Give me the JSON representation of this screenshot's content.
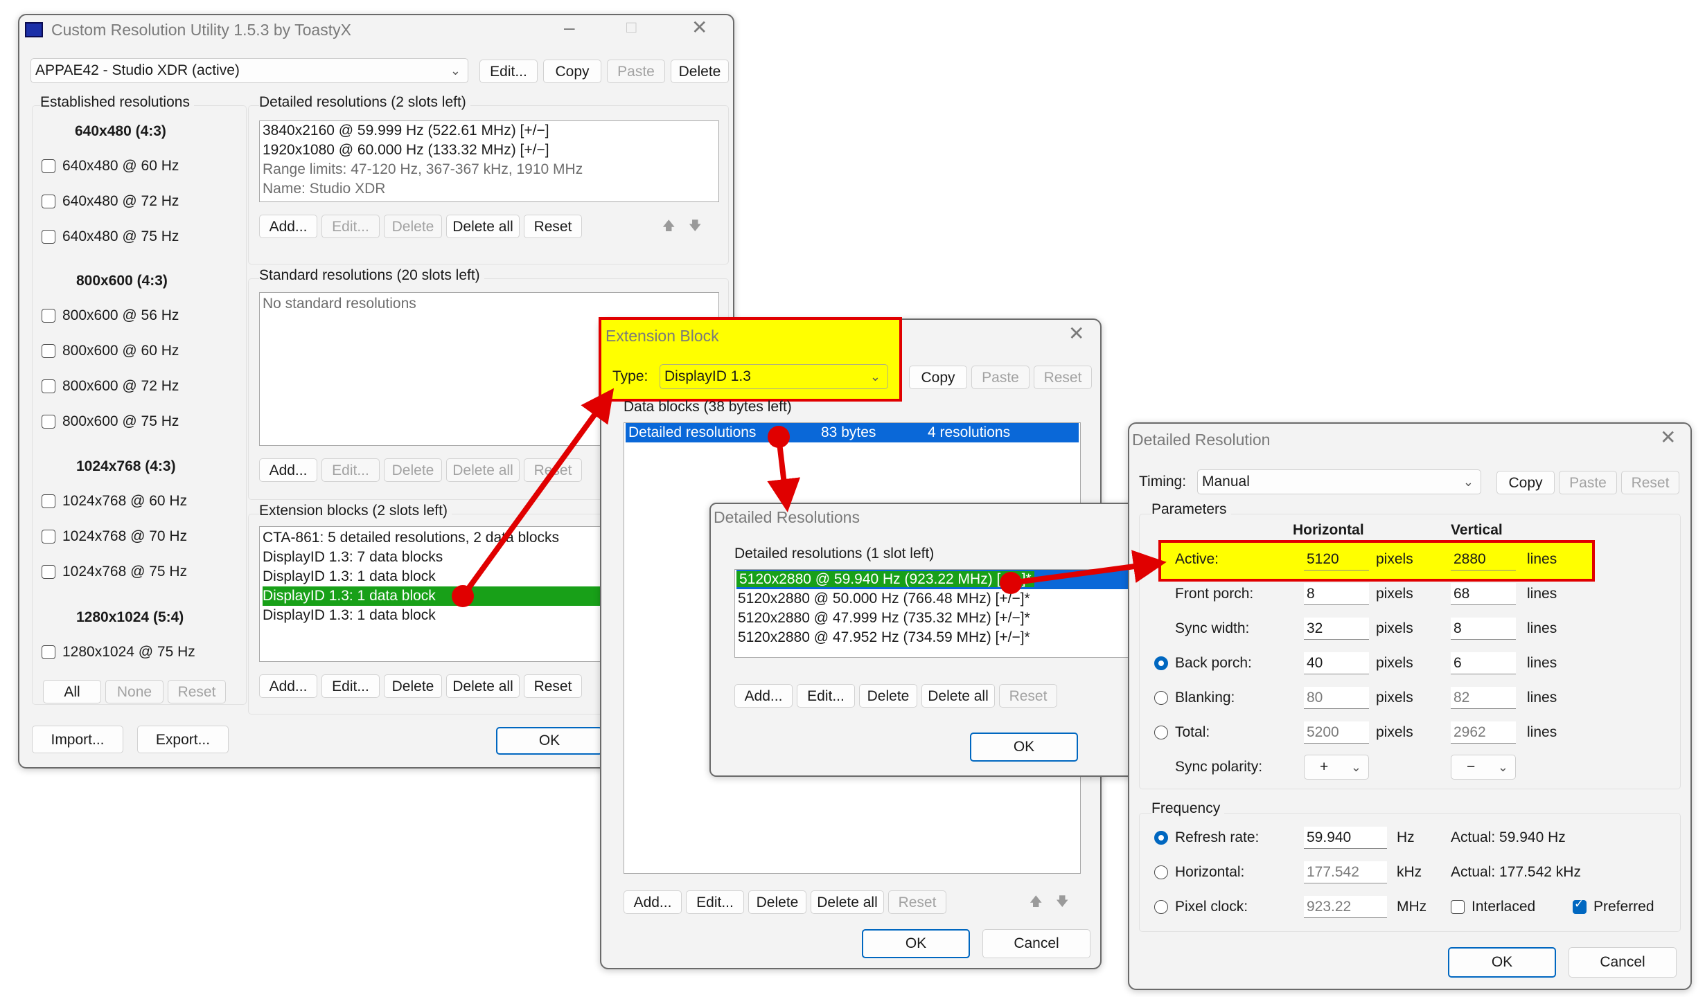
{
  "cru": {
    "title": "Custom Resolution Utility 1.5.3 by ToastyX",
    "monitor": "APPAE42 - Studio XDR (active)",
    "top_buttons": [
      "Edit...",
      "Copy",
      "Paste",
      "Delete"
    ],
    "established_label": "Established resolutions",
    "established": [
      {
        "title": "640x480 (4:3)",
        "items": [
          "640x480 @ 60 Hz",
          "640x480 @ 72 Hz",
          "640x480 @ 75 Hz"
        ]
      },
      {
        "title": "800x600 (4:3)",
        "items": [
          "800x600 @ 56 Hz",
          "800x600 @ 60 Hz",
          "800x600 @ 72 Hz",
          "800x600 @ 75 Hz"
        ]
      },
      {
        "title": "1024x768 (4:3)",
        "items": [
          "1024x768 @ 60 Hz",
          "1024x768 @ 70 Hz",
          "1024x768 @ 75 Hz"
        ]
      },
      {
        "title": "1280x1024 (5:4)",
        "items": [
          "1280x1024 @ 75 Hz"
        ]
      }
    ],
    "est_buttons": [
      "All",
      "None",
      "Reset"
    ],
    "detailed_label": "Detailed resolutions (2 slots left)",
    "detailed_list": [
      "3840x2160 @ 59.999 Hz (522.61 MHz) [+/−]",
      "1920x1080 @ 60.000 Hz (133.32 MHz) [+/−]",
      "Range limits: 47-120 Hz, 367-367 kHz, 1910 MHz",
      "Name: Studio XDR"
    ],
    "detailed_buttons": [
      "Add...",
      "Edit...",
      "Delete",
      "Delete all",
      "Reset"
    ],
    "standard_label": "Standard resolutions (20 slots left)",
    "standard_empty": "No standard resolutions",
    "standard_buttons": [
      "Add...",
      "Edit...",
      "Delete",
      "Delete all",
      "Reset"
    ],
    "extension_label": "Extension blocks (2 slots left)",
    "extension_list": [
      "CTA-861: 5 detailed resolutions, 2 data blocks",
      "DisplayID 1.3: 7 data blocks",
      "DisplayID 1.3: 1 data block",
      "DisplayID 1.3: 1 data block",
      "DisplayID 1.3: 1 data block"
    ],
    "extension_buttons": [
      "Add...",
      "Edit...",
      "Delete",
      "Delete all",
      "Reset"
    ],
    "import": "Import...",
    "export": "Export...",
    "ok": "OK"
  },
  "ext": {
    "title": "Extension Block",
    "type_label": "Type:",
    "type_value": "DisplayID 1.3",
    "buttons": [
      "Copy",
      "Paste",
      "Reset"
    ],
    "data_label": "Data blocks (38 bytes left)",
    "row": {
      "name": "Detailed resolutions",
      "bytes": "83 bytes",
      "count": "4 resolutions"
    },
    "bottom_buttons": [
      "Add...",
      "Edit...",
      "Delete",
      "Delete all",
      "Reset"
    ],
    "ok": "OK",
    "cancel": "Cancel"
  },
  "dres": {
    "title": "Detailed Resolutions",
    "label": "Detailed resolutions (1 slot left)",
    "list": [
      "5120x2880 @ 59.940 Hz (923.22 MHz) [+/−]*",
      "5120x2880 @ 50.000 Hz (766.48 MHz) [+/−]*",
      "5120x2880 @ 47.999 Hz (735.32 MHz) [+/−]*",
      "5120x2880 @ 47.952 Hz (734.59 MHz) [+/−]*"
    ],
    "buttons": [
      "Add...",
      "Edit...",
      "Delete",
      "Delete all",
      "Reset"
    ],
    "ok": "OK"
  },
  "dr": {
    "title": "Detailed Resolution",
    "timing_label": "Timing:",
    "timing_value": "Manual",
    "buttons": [
      "Copy",
      "Paste",
      "Reset"
    ],
    "params_label": "Parameters",
    "col_h": "Horizontal",
    "col_v": "Vertical",
    "rows": [
      {
        "label": "Active:",
        "h": "5120",
        "hu": "pixels",
        "v": "2880",
        "vu": "lines"
      },
      {
        "label": "Front porch:",
        "h": "8",
        "hu": "pixels",
        "v": "68",
        "vu": "lines"
      },
      {
        "label": "Sync width:",
        "h": "32",
        "hu": "pixels",
        "v": "8",
        "vu": "lines"
      },
      {
        "label": "Back porch:",
        "h": "40",
        "hu": "pixels",
        "v": "6",
        "vu": "lines"
      },
      {
        "label": "Blanking:",
        "h": "80",
        "hu": "pixels",
        "v": "82",
        "vu": "lines"
      },
      {
        "label": "Total:",
        "h": "5200",
        "hu": "pixels",
        "v": "2962",
        "vu": "lines"
      }
    ],
    "sync_label": "Sync polarity:",
    "sync_h": "+",
    "sync_v": "−",
    "freq_label": "Frequency",
    "refresh_label": "Refresh rate:",
    "refresh_value": "59.940",
    "refresh_unit": "Hz",
    "refresh_actual": "Actual: 59.940 Hz",
    "hfreq_label": "Horizontal:",
    "hfreq_value": "177.542",
    "hfreq_unit": "kHz",
    "hfreq_actual": "Actual: 177.542 kHz",
    "pclk_label": "Pixel clock:",
    "pclk_value": "923.22",
    "pclk_unit": "MHz",
    "interlaced": "Interlaced",
    "preferred": "Preferred",
    "ok": "OK",
    "cancel": "Cancel"
  },
  "colors": {
    "highlight": "#ffff00",
    "annotation_red": "#e00000",
    "selection_blue": "#0a68d8",
    "selection_green": "#18a018"
  }
}
